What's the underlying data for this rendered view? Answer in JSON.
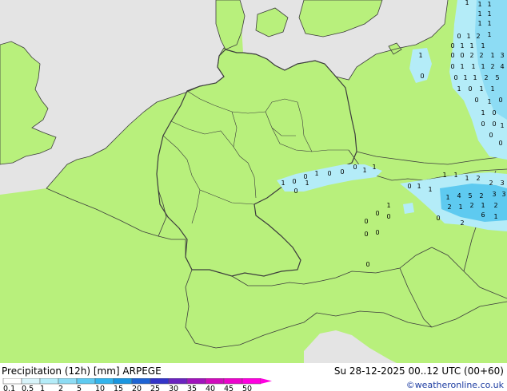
{
  "footer": {
    "title": "Precipitation (12h) [mm] ARPEGE",
    "validity": "Su 28-12-2025 00..12 UTC (00+60)",
    "credit": "©weatheronline.co.uk"
  },
  "legend": {
    "labels": [
      "0.1",
      "0.5",
      "1",
      "2",
      "5",
      "10",
      "15",
      "20",
      "25",
      "30",
      "35",
      "40",
      "45",
      "50"
    ],
    "colors": [
      "#ffffff",
      "#d8f4fa",
      "#b4ecf8",
      "#8ddcf4",
      "#5ecaf0",
      "#32b4ec",
      "#1a96e0",
      "#1e64d4",
      "#3434c8",
      "#6a24c0",
      "#a014bc",
      "#d00cbc",
      "#ec04cc",
      "#ff00e0"
    ]
  },
  "colors": {
    "land": "#b8f07c",
    "sea": "#e4e4e4",
    "border": "#3c3c3c",
    "precip_light": "#b4ecf8",
    "precip_medium": "#8ddcf4",
    "precip_heavy": "#5ecaf0"
  },
  "precip_labels": [
    "1",
    "1",
    "1",
    "1",
    "1",
    "1",
    "1",
    "0",
    "1",
    "2",
    "1",
    "0",
    "1",
    "1",
    "1",
    "0",
    "0",
    "2",
    "2",
    "1",
    "3",
    "1",
    "0",
    "1",
    "1",
    "1",
    "2",
    "4",
    "0",
    "1",
    "1",
    "2",
    "5",
    "0",
    "1",
    "0",
    "1",
    "1",
    "0",
    "1",
    "0",
    "1",
    "0",
    "0",
    "0",
    "1",
    "0",
    "0",
    "1",
    "0",
    "0",
    "1",
    "1",
    "0",
    "0",
    "0",
    "1",
    "1",
    "0",
    "0",
    "1",
    "1",
    "1",
    "1",
    "1",
    "2",
    "2",
    "3",
    "1",
    "4",
    "5",
    "2",
    "3",
    "3",
    "2",
    "1",
    "2",
    "1",
    "2",
    "6",
    "2",
    "0",
    "1",
    "1",
    "0",
    "0",
    "0",
    "0",
    "0",
    "0"
  ]
}
